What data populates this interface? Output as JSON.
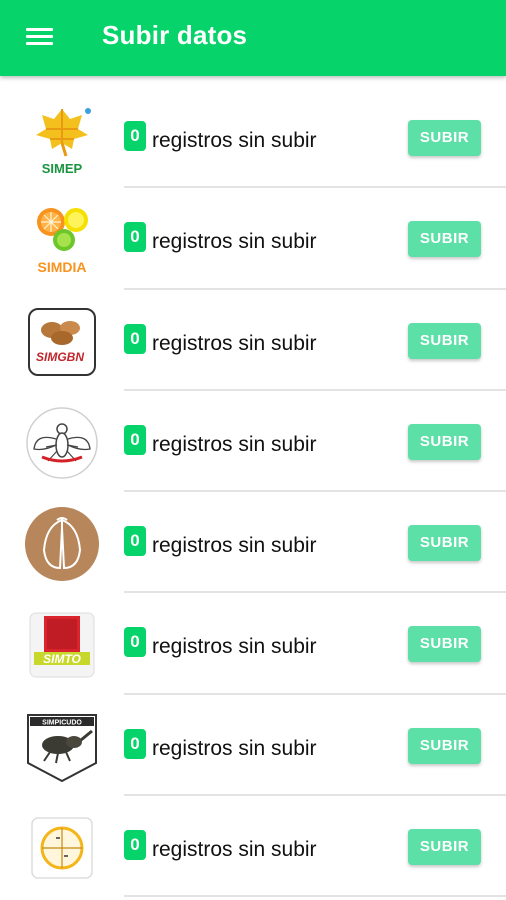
{
  "appbar": {
    "title": "Subir datos",
    "menu_icon": "hamburger-menu-icon",
    "color": "#06d36a"
  },
  "rows": [
    {
      "logo_name": "simep-logo",
      "logo_text": "SIMEP",
      "count": "0",
      "text": "registros sin subir",
      "button": "SUBIR"
    },
    {
      "logo_name": "simdia-logo",
      "logo_text": "SIMDIA",
      "count": "0",
      "text": "registros sin subir",
      "button": "SUBIR"
    },
    {
      "logo_name": "simgbn-logo",
      "logo_text": "SIMGBN",
      "count": "0",
      "text": "registros sin subir",
      "button": "SUBIR"
    },
    {
      "logo_name": "fly-logo",
      "logo_text": "",
      "count": "0",
      "text": "registros sin subir",
      "button": "SUBIR"
    },
    {
      "logo_name": "moth-wing-logo",
      "logo_text": "",
      "count": "0",
      "text": "registros sin subir",
      "button": "SUBIR"
    },
    {
      "logo_name": "simto-logo",
      "logo_text": "SIMTO",
      "count": "0",
      "text": "registros sin subir",
      "button": "SUBIR"
    },
    {
      "logo_name": "simpicudo-logo",
      "logo_text": "SIMPICUDO",
      "count": "0",
      "text": "registros sin subir",
      "button": "SUBIR"
    },
    {
      "logo_name": "citrus-chart-logo",
      "logo_text": "",
      "count": "0",
      "text": "registros sin subir",
      "button": "SUBIR"
    }
  ],
  "colors": {
    "accent": "#06d36a",
    "button": "#5ddfa8"
  }
}
